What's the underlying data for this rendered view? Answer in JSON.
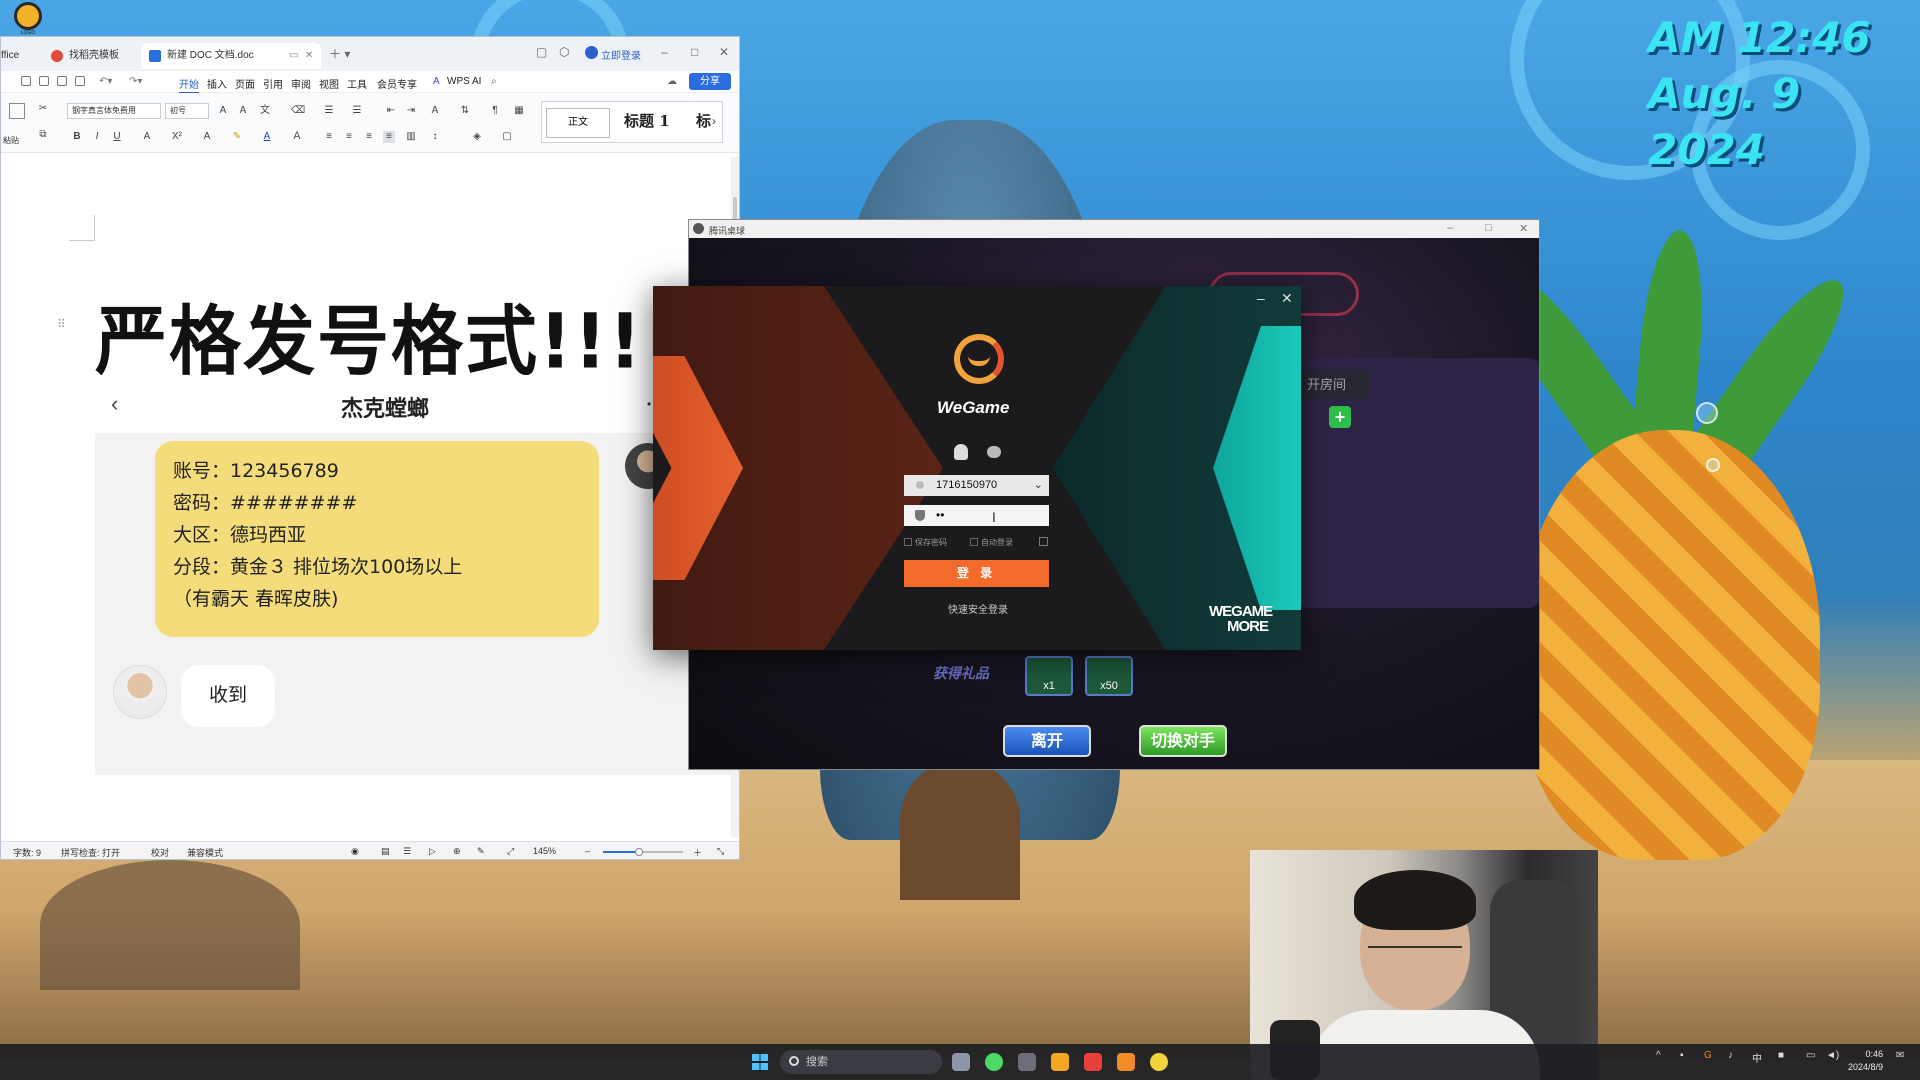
{
  "overlay_clock": {
    "time": "AM 12:46",
    "date": "Aug. 9 2024"
  },
  "wps": {
    "tabs": [
      {
        "label": "ffice",
        "icon": "office-icon",
        "color": "#d8dde6"
      },
      {
        "label": "找稻壳模板",
        "icon": "docer-icon",
        "color": "#e24a3b"
      },
      {
        "label": "新建 DOC 文档.doc",
        "icon": "word-icon",
        "color": "#2b6de0"
      }
    ],
    "login_label": "立即登录",
    "menu": [
      "开始",
      "插入",
      "页面",
      "引用",
      "审阅",
      "视图",
      "工具",
      "会员专享",
      "WPS AI"
    ],
    "active_menu": "开始",
    "share_label": "分享",
    "font_name": "钢字真言体免费用",
    "font_size": "初号",
    "paste_label": "粘贴",
    "style_normal": "正文",
    "style_h1": "标题 1",
    "style_h2": "标",
    "doc": {
      "title": "严格发号格式!!!",
      "chat": {
        "back_icon": "chevron-left-icon",
        "contact_name": "杰克螳螂",
        "message_lines": [
          "账号：123456789",
          "密码：########",
          "大区：德玛西亚",
          "分段：黄金３ 排位场次100场以上",
          "（有霸天 春晖皮肤)"
        ],
        "reply": "收到"
      }
    },
    "status": {
      "word_count": "字数: 9",
      "spell_check": "拼写检查: 打开",
      "proofread": "校对",
      "compat_mode": "兼容模式",
      "zoom": "145%",
      "zoom_fraction": 0.45
    }
  },
  "pool_window": {
    "title": "腾讯桌球",
    "room_label": "开房间",
    "reward_label": "获得礼品",
    "reward_items": [
      {
        "count": "x1"
      },
      {
        "count": "x50"
      }
    ],
    "leave_button": "离开",
    "switch_button": "切换对手"
  },
  "wegame": {
    "brand": "WeGame",
    "login_icons": [
      "qq-icon",
      "wechat-icon"
    ],
    "account": "1716150970",
    "password_mask": "••",
    "remember_password": "保存密码",
    "auto_login": "自动登录",
    "login_button": "登 录",
    "quick_login": "快速安全登录",
    "footer_brand_line1": "WEGAME",
    "footer_brand_line2": "MORE"
  },
  "taskbar": {
    "search_placeholder": "搜索",
    "apps": [
      {
        "name": "app-icon-1",
        "color": "#8e97a8"
      },
      {
        "name": "app-icon-2",
        "color": "#4cd964"
      },
      {
        "name": "app-icon-3",
        "color": "#6c6f78"
      },
      {
        "name": "app-icon-4",
        "color": "#f5a623"
      },
      {
        "name": "wps-icon",
        "color": "#e8413c"
      },
      {
        "name": "wegame-icon",
        "color": "#f28c28"
      },
      {
        "name": "app-icon-7",
        "color": "#f2d33b"
      }
    ],
    "ime": "中",
    "time": "0:46",
    "date": "2024/8/9"
  }
}
